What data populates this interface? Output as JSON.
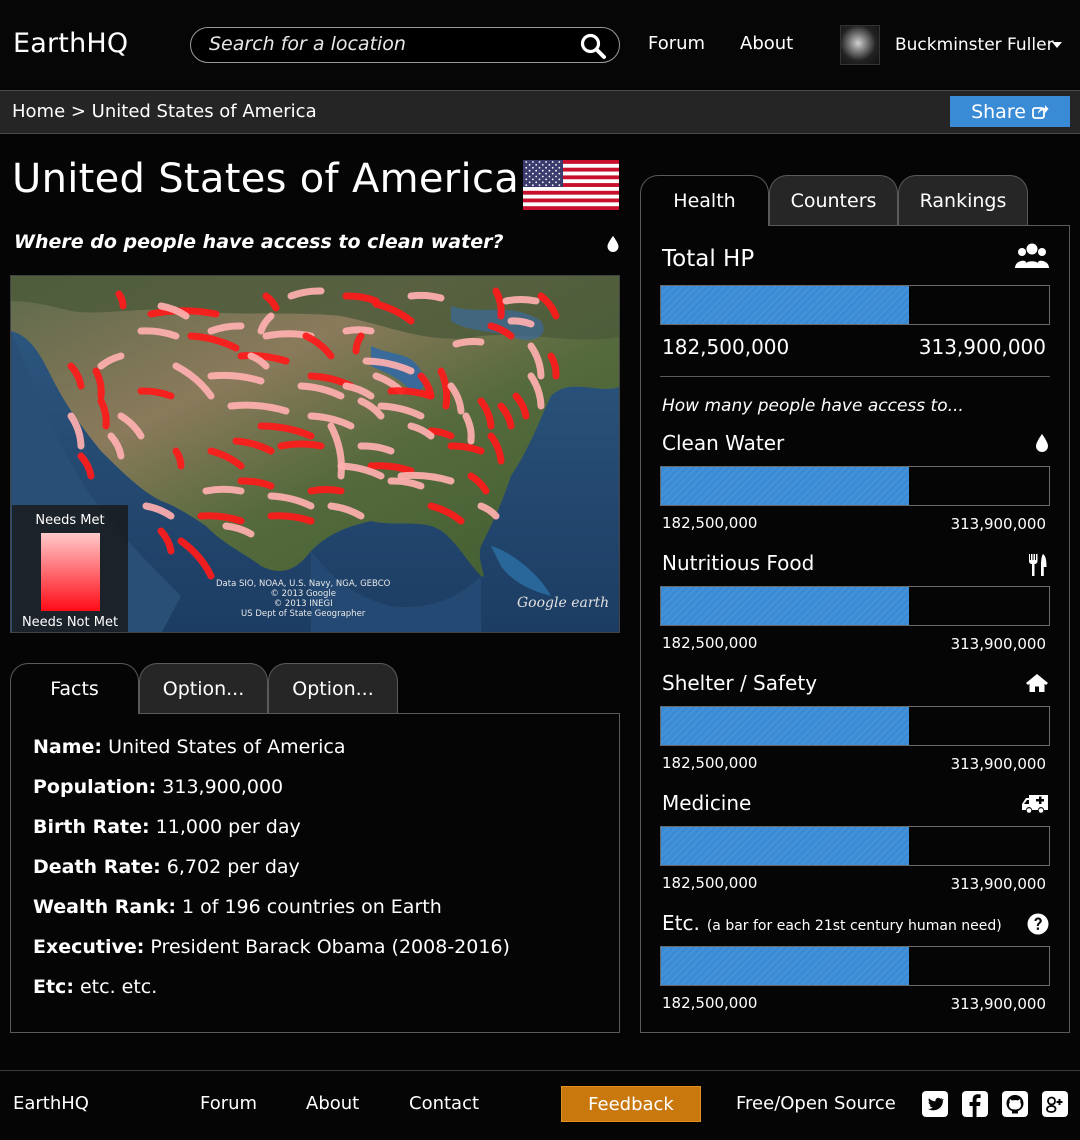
{
  "header": {
    "logo": "EarthHQ",
    "search_placeholder": "Search for a location",
    "nav": [
      "Forum",
      "About"
    ],
    "user_name": "Buckminster Fuller"
  },
  "breadcrumb": {
    "text": "Home > United States of America",
    "share_label": "Share"
  },
  "country": {
    "title": "United States of America",
    "question": "Where do people have access to clean water?"
  },
  "map": {
    "legend_top": "Needs Met",
    "legend_bottom": "Needs Not Met",
    "credit_lines": [
      "Data SIO, NOAA, U.S. Navy, NGA, GEBCO",
      "© 2013 Google",
      "© 2013 INEGI",
      "US Dept of State Geographer"
    ],
    "brand": "Google earth"
  },
  "facts_tabs": [
    "Facts",
    "Option...",
    "Option..."
  ],
  "facts": [
    {
      "label": "Name:",
      "value": "United States of America"
    },
    {
      "label": "Population:",
      "value": "313,900,000"
    },
    {
      "label": "Birth Rate:",
      "value": "11,000 per day"
    },
    {
      "label": "Death Rate:",
      "value": "6,702 per day"
    },
    {
      "label": "Wealth Rank:",
      "value": "1 of 196 countries on Earth"
    },
    {
      "label": "Executive:",
      "value": "President Barack Obama (2008-2016)"
    },
    {
      "label": "Etc:",
      "value": "etc. etc."
    }
  ],
  "right_tabs": [
    "Health",
    "Counters",
    "Rankings"
  ],
  "total_hp": {
    "label": "Total HP",
    "current": "182,500,000",
    "max": "313,900,000",
    "fill": 0.64
  },
  "access_question": "How many people have access to...",
  "needs": [
    {
      "label": "Clean Water",
      "sub": "",
      "icon": "drop-icon",
      "current": "182,500,000",
      "max": "313,900,000",
      "fill": 0.64
    },
    {
      "label": "Nutritious Food",
      "sub": "",
      "icon": "fork-knife-icon",
      "current": "182,500,000",
      "max": "313,900,000",
      "fill": 0.64
    },
    {
      "label": "Shelter / Safety",
      "sub": "",
      "icon": "home-icon",
      "current": "182,500,000",
      "max": "313,900,000",
      "fill": 0.64
    },
    {
      "label": "Medicine",
      "sub": "",
      "icon": "ambulance-icon",
      "current": "182,500,000",
      "max": "313,900,000",
      "fill": 0.64
    },
    {
      "label": "Etc.",
      "sub": "(a bar for each 21st century human need)",
      "icon": "question-icon",
      "current": "182,500,000",
      "max": "313,900,000",
      "fill": 0.64
    }
  ],
  "footer": {
    "logo": "EarthHQ",
    "links": [
      "Forum",
      "About",
      "Contact"
    ],
    "feedback": "Feedback",
    "open_source": "Free/Open Source",
    "social": [
      "twitter-icon",
      "facebook-icon",
      "github-icon",
      "google-plus-icon"
    ]
  },
  "colors": {
    "accent": "#3a8bd5",
    "feedback": "#c9780e",
    "map_red": "#ff1a1a",
    "map_pink": "#ffb0b0"
  }
}
